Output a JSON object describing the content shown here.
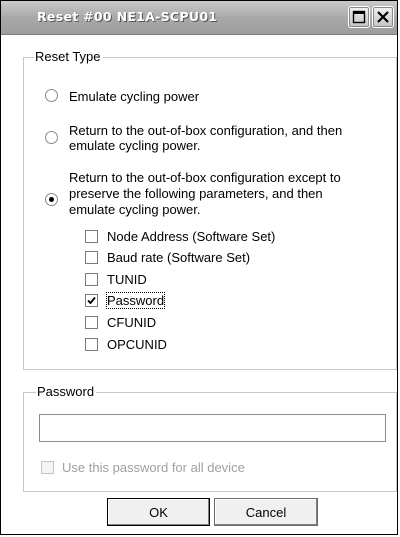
{
  "window": {
    "title": "Reset #00 NE1A-SCPU01"
  },
  "reset_type": {
    "legend": "Reset Type",
    "options": [
      {
        "lines": [
          "Emulate cycling power"
        ],
        "selected": false
      },
      {
        "lines": [
          "Return to the out-of-box configuration, and then",
          "emulate cycling power."
        ],
        "selected": false
      },
      {
        "lines": [
          "Return to the out-of-box configuration except to",
          "preserve the following parameters, and then",
          "emulate cycling power."
        ],
        "selected": true
      }
    ],
    "parameters": [
      {
        "label": "Node Address (Software Set)",
        "checked": false
      },
      {
        "label": "Baud rate (Software Set)",
        "checked": false
      },
      {
        "label": "TUNID",
        "checked": false
      },
      {
        "label": "Password",
        "checked": true
      },
      {
        "label": "CFUNID",
        "checked": false
      },
      {
        "label": "OPCUNID",
        "checked": false
      }
    ]
  },
  "password": {
    "legend": "Password",
    "value": "",
    "use_for_all_label": "Use this password for all device",
    "use_for_all_checked": false
  },
  "buttons": {
    "ok_label": "OK",
    "cancel_label": "Cancel"
  },
  "icons": {
    "maximize": "maximize-icon",
    "close": "close-icon"
  }
}
